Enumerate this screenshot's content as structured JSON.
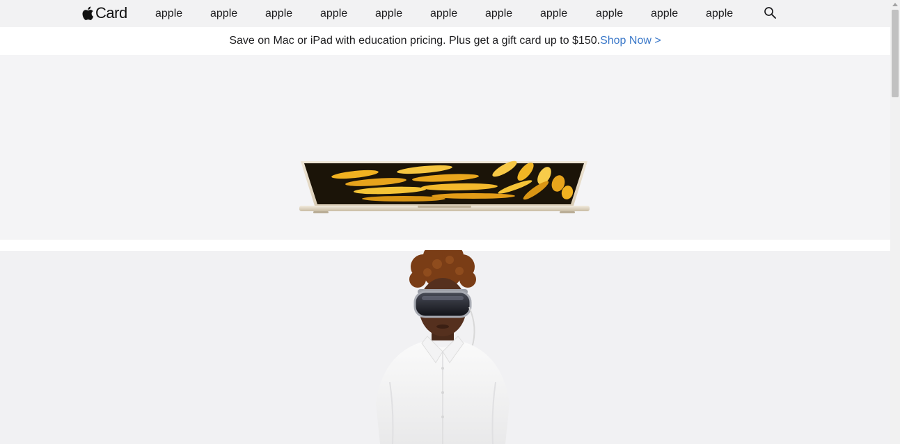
{
  "nav": {
    "logo_text": "Card",
    "items": [
      "apple",
      "apple",
      "apple",
      "apple",
      "apple",
      "apple",
      "apple",
      "apple",
      "apple",
      "apple",
      "apple"
    ],
    "search_icon": "search-icon"
  },
  "ribbon": {
    "text": "Save on Mac or iPad with education pricing. Plus get a gift card up to $150.",
    "link": "Shop Now >"
  },
  "tiles": {
    "first_image": "laptop",
    "second_image": "person-with-headset"
  },
  "colors": {
    "nav_bg": "#f2f2f3",
    "link": "#3a78c9",
    "tile_bg": "#f4f4f6"
  }
}
